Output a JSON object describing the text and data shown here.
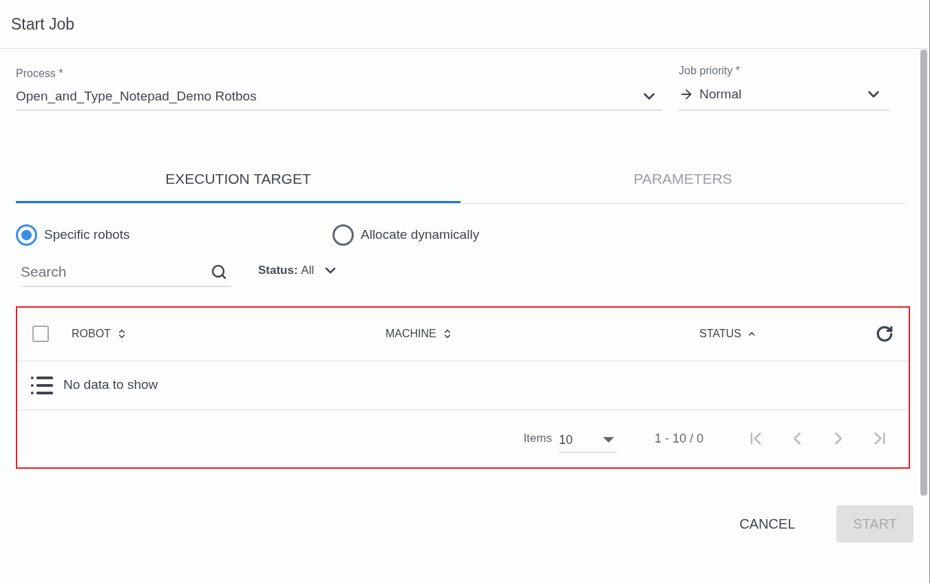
{
  "dialog": {
    "title": "Start Job"
  },
  "process": {
    "label": "Process *",
    "value": "Open_and_Type_Notepad_Demo Rotbos"
  },
  "priority": {
    "label": "Job priority *",
    "value": "Normal"
  },
  "tabs": [
    {
      "label": "EXECUTION TARGET",
      "selected": true
    },
    {
      "label": "PARAMETERS",
      "selected": false
    }
  ],
  "target_options": [
    {
      "label": "Specific robots",
      "selected": true
    },
    {
      "label": "Allocate dynamically",
      "selected": false
    }
  ],
  "search": {
    "placeholder": "Search"
  },
  "status_filter": {
    "label": "Status:",
    "value": "All"
  },
  "table": {
    "select_all": {
      "checked": false
    },
    "columns": [
      {
        "label": "ROBOT",
        "sorted": false
      },
      {
        "label": "MACHINE",
        "sorted": false
      },
      {
        "label": "STATUS",
        "sorted": true
      }
    ],
    "empty_message": "No data to show",
    "pager": {
      "items_label": "Items",
      "page_size": "10",
      "range": "1 - 10 / 0",
      "first_disabled": true,
      "prev_disabled": true,
      "next_disabled": true,
      "last_disabled": true
    }
  },
  "buttons": [
    {
      "label": "CANCEL",
      "disabled": false
    },
    {
      "label": "START",
      "disabled": true
    }
  ]
}
